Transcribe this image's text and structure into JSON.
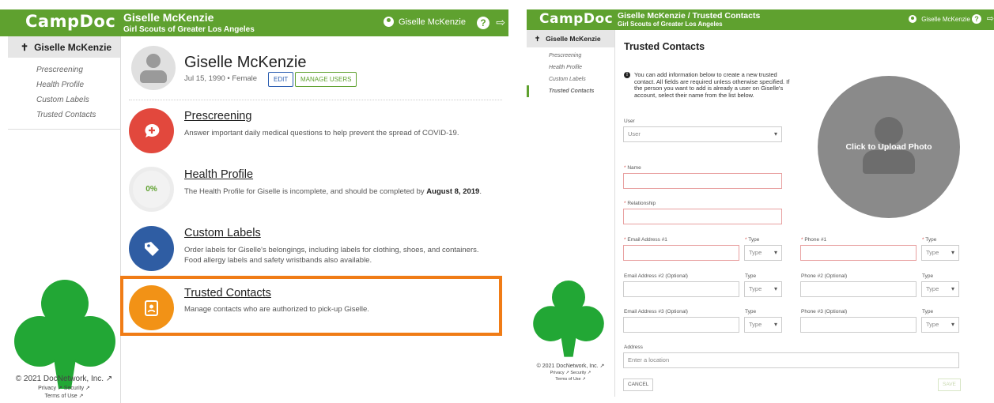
{
  "left": {
    "logo": "CampDoc",
    "header_title": "Giselle McKenzie",
    "header_sub": "Girl Scouts of Greater Los Angeles",
    "user_name": "Giselle McKenzie",
    "sidebar_active": "Giselle McKenzie",
    "sidebar_items": [
      "Prescreening",
      "Health Profile",
      "Custom Labels",
      "Trusted Contacts"
    ],
    "profile_name": "Giselle McKenzie",
    "profile_meta": "Jul 15, 1990 • Female",
    "edit_label": "EDIT",
    "manage_users_label": "MANAGE USERS",
    "rows": [
      {
        "title": "Prescreening",
        "desc": "Answer important daily medical questions to help prevent the spread of COVID-19."
      },
      {
        "title": "Health Profile",
        "desc": "The Health Profile for Giselle is incomplete, and should be completed by ",
        "desc_bold": "August 8, 2019",
        "desc_tail": ".",
        "progress": "0%"
      },
      {
        "title": "Custom Labels",
        "desc": "Order labels for Giselle's belongings, including labels for clothing, shoes, and containers. Food allergy labels and safety wristbands also available."
      },
      {
        "title": "Trusted Contacts",
        "desc": "Manage contacts who are authorized to pick-up Giselle."
      }
    ],
    "copyright": "© 2021 DocNetwork, Inc. ↗",
    "footer_links": "Privacy ↗   Security ↗",
    "terms": "Terms of Use ↗"
  },
  "right": {
    "logo": "CampDoc",
    "header_title": "Giselle McKenzie / Trusted Contacts",
    "header_sub": "Girl Scouts of Greater Los Angeles",
    "user_name": "Giselle McKenzie",
    "sidebar_active": "Giselle McKenzie",
    "sidebar_items": [
      "Prescreening",
      "Health Profile",
      "Custom Labels",
      "Trusted Contacts"
    ],
    "page_title": "Trusted Contacts",
    "info_text": "You can add information below to create a new trusted contact. All fields are required unless otherwise specified. If the person you want to add is already a user on Giselle's account, select their name from the list below.",
    "upload_text": "Click to Upload Photo",
    "user_label": "User",
    "user_value": "User",
    "name_label": "Name",
    "relationship_label": "Relationship",
    "email1_label": "Email Address #1",
    "email2_label": "Email Address #2 (Optional)",
    "email3_label": "Email Address #3 (Optional)",
    "phone1_label": "Phone #1",
    "phone2_label": "Phone #2 (Optional)",
    "phone3_label": "Phone #3 (Optional)",
    "type_label": "Type",
    "type_value": "Type",
    "address_label": "Address",
    "address_placeholder": "Enter a location",
    "cancel_label": "CANCEL",
    "save_label": "SAVE",
    "copyright": "© 2021 DocNetwork, Inc. ↗",
    "footer_links": "Privacy ↗   Security ↗",
    "terms": "Terms of Use ↗"
  },
  "colors": {
    "brand": "#5fa12f",
    "highlight": "#f07c16",
    "prescreen": "#e2483d",
    "labels": "#2f5da3",
    "contacts": "#f29216"
  }
}
